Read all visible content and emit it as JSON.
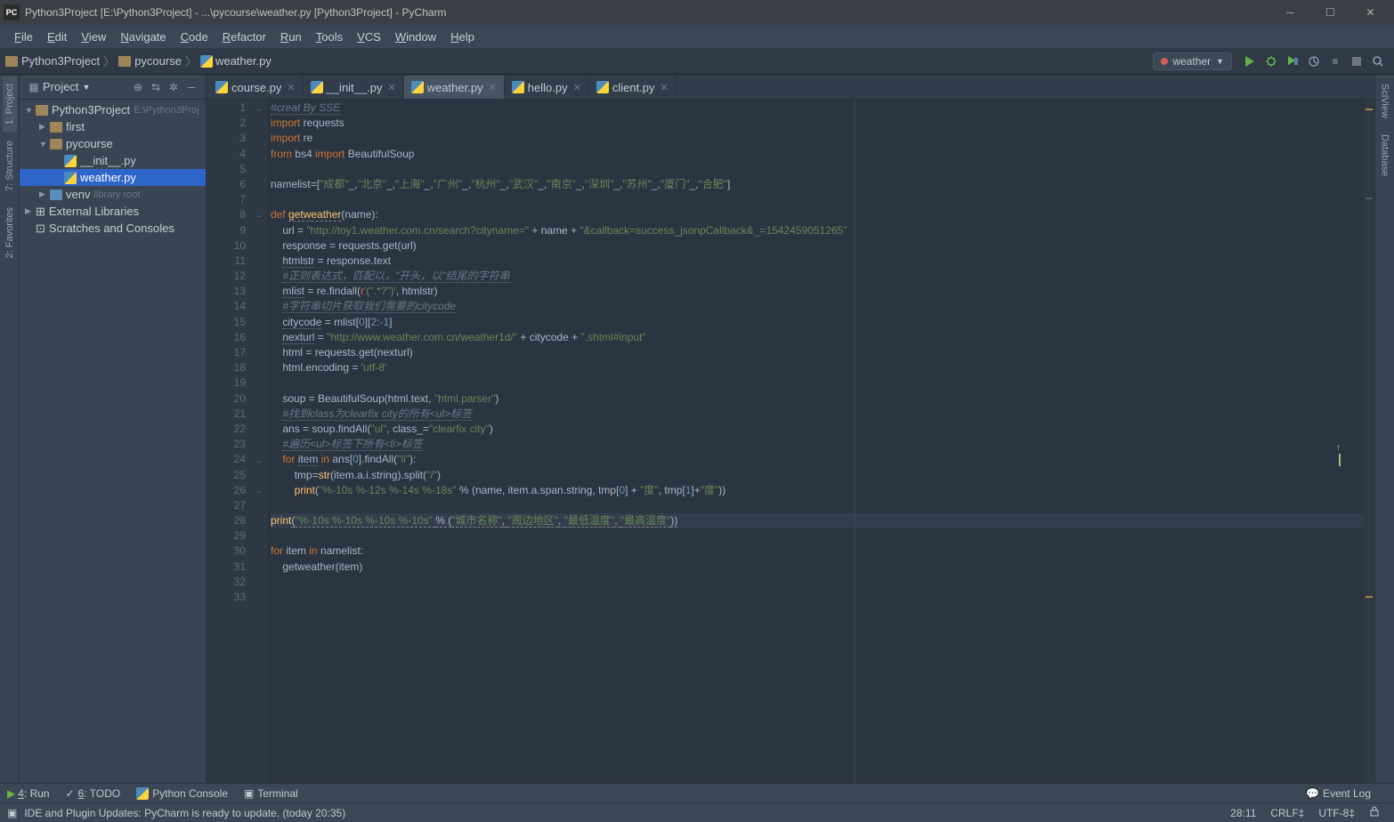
{
  "title_bar": {
    "app_badge": "PC",
    "title": "Python3Project [E:\\Python3Project] - ...\\pycourse\\weather.py [Python3Project] - PyCharm"
  },
  "menu": [
    "File",
    "Edit",
    "View",
    "Navigate",
    "Code",
    "Refactor",
    "Run",
    "Tools",
    "VCS",
    "Window",
    "Help"
  ],
  "breadcrumb": {
    "project": "Python3Project",
    "folder": "pycourse",
    "file": "weather.py"
  },
  "run_config": {
    "label": "weather"
  },
  "project_panel": {
    "title": "Project",
    "nodes": [
      {
        "depth": 0,
        "arrow": "▼",
        "icon": "dir",
        "text": "Python3Project",
        "muted": "E:\\Python3Proj"
      },
      {
        "depth": 1,
        "arrow": "▶",
        "icon": "dir",
        "text": "first"
      },
      {
        "depth": 1,
        "arrow": "▼",
        "icon": "dir",
        "text": "pycourse"
      },
      {
        "depth": 2,
        "arrow": "",
        "icon": "py",
        "text": "__init__.py"
      },
      {
        "depth": 2,
        "arrow": "",
        "icon": "py",
        "text": "weather.py",
        "selected": true
      },
      {
        "depth": 1,
        "arrow": "▶",
        "icon": "dir-blue",
        "text": "venv",
        "muted": "library root"
      },
      {
        "depth": 0,
        "arrow": "▶",
        "icon": "lib",
        "text": "External Libraries"
      },
      {
        "depth": 0,
        "arrow": "",
        "icon": "scr",
        "text": "Scratches and Consoles"
      }
    ]
  },
  "tabs": [
    {
      "label": "course.py",
      "active": false
    },
    {
      "label": "__init__.py",
      "active": false
    },
    {
      "label": "weather.py",
      "active": true
    },
    {
      "label": "hello.py",
      "active": false
    },
    {
      "label": "client.py",
      "active": false
    }
  ],
  "code": [
    {
      "n": 1,
      "tokens": [
        [
          "cmt under",
          "#creat By SSE"
        ]
      ]
    },
    {
      "n": 2,
      "tokens": [
        [
          "kw",
          "import"
        ],
        [
          "txt",
          " requests"
        ]
      ]
    },
    {
      "n": 3,
      "tokens": [
        [
          "kw",
          "import"
        ],
        [
          "txt",
          " re"
        ]
      ]
    },
    {
      "n": 4,
      "tokens": [
        [
          "kw",
          "from"
        ],
        [
          "txt",
          " bs4 "
        ],
        [
          "kw",
          "import"
        ],
        [
          "txt",
          " BeautifulSoup"
        ]
      ]
    },
    {
      "n": 5,
      "tokens": []
    },
    {
      "n": 6,
      "tokens": [
        [
          "txt",
          "namelist"
        ],
        [
          "op",
          "=["
        ],
        [
          "str",
          "\"成都\""
        ],
        [
          "op",
          "_,"
        ],
        [
          "str",
          "\"北京\""
        ],
        [
          "op",
          "_,"
        ],
        [
          "str",
          "\"上海\""
        ],
        [
          "op",
          "_,"
        ],
        [
          "str",
          "\"广州\""
        ],
        [
          "op",
          "_,"
        ],
        [
          "str",
          "\"杭州\""
        ],
        [
          "op",
          "_,"
        ],
        [
          "str",
          "\"武汉\""
        ],
        [
          "op",
          "_,"
        ],
        [
          "str",
          "\"南京\""
        ],
        [
          "op",
          "_,"
        ],
        [
          "str",
          "\"深圳\""
        ],
        [
          "op",
          "_,"
        ],
        [
          "str",
          "\"苏州\""
        ],
        [
          "op",
          "_,"
        ],
        [
          "str",
          "\"厦门\""
        ],
        [
          "op",
          "_,"
        ],
        [
          "str",
          "\"合肥\""
        ],
        [
          "op",
          "]"
        ]
      ]
    },
    {
      "n": 7,
      "tokens": []
    },
    {
      "n": 8,
      "tokens": [
        [
          "kw",
          "def "
        ],
        [
          "fn under-w",
          "getweather"
        ],
        [
          "punc",
          "("
        ],
        [
          "par",
          "name"
        ],
        [
          "punc",
          ")"
        ],
        [
          "op",
          ":"
        ]
      ]
    },
    {
      "n": 9,
      "indent": 1,
      "tokens": [
        [
          "txt",
          "url "
        ],
        [
          "op",
          "= "
        ],
        [
          "str",
          "\"http://toy1.weather.com.cn/search?cityname=\""
        ],
        [
          "op",
          " + "
        ],
        [
          "txt",
          "name"
        ],
        [
          "op",
          " + "
        ],
        [
          "str",
          "\"&callback=success_jsonpCallback&_=1542459051265\""
        ]
      ]
    },
    {
      "n": 10,
      "indent": 1,
      "tokens": [
        [
          "txt",
          "response "
        ],
        [
          "op",
          "= "
        ],
        [
          "txt",
          "requests"
        ],
        [
          "op",
          "."
        ],
        [
          "txt",
          "get"
        ],
        [
          "punc",
          "("
        ],
        [
          "txt",
          "url"
        ],
        [
          "punc",
          ")"
        ]
      ]
    },
    {
      "n": 11,
      "indent": 1,
      "tokens": [
        [
          "txt under",
          "htmlstr"
        ],
        [
          "op",
          " = "
        ],
        [
          "txt",
          "response"
        ],
        [
          "op",
          "."
        ],
        [
          "txt",
          "text"
        ]
      ]
    },
    {
      "n": 12,
      "indent": 1,
      "tokens": [
        [
          "cmt under",
          "#正则表达式，匹配以，\"开头，以\"结尾的字符串"
        ]
      ]
    },
    {
      "n": 13,
      "indent": 1,
      "tokens": [
        [
          "txt under",
          "mlist"
        ],
        [
          "op",
          " = "
        ],
        [
          "txt",
          "re"
        ],
        [
          "op",
          "."
        ],
        [
          "txt",
          "findall"
        ],
        [
          "punc",
          "("
        ],
        [
          "kw",
          "r"
        ],
        [
          "str",
          "'(\".*?\")'"
        ],
        [
          "op",
          ", "
        ],
        [
          "txt",
          "htmlstr"
        ],
        [
          "punc",
          ")"
        ]
      ]
    },
    {
      "n": 14,
      "indent": 1,
      "tokens": [
        [
          "cmt under",
          "#字符串切片获取我们需要的citycode"
        ]
      ]
    },
    {
      "n": 15,
      "indent": 1,
      "tokens": [
        [
          "txt under",
          "citycode"
        ],
        [
          "op",
          " = "
        ],
        [
          "txt",
          "mlist"
        ],
        [
          "punc",
          "["
        ],
        [
          "num",
          "0"
        ],
        [
          "punc",
          "]["
        ],
        [
          "num",
          "2"
        ],
        [
          "op",
          ":"
        ],
        [
          "num",
          "-1"
        ],
        [
          "punc",
          "]"
        ]
      ]
    },
    {
      "n": 16,
      "indent": 1,
      "tokens": [
        [
          "txt under",
          "nexturl"
        ],
        [
          "op",
          " = "
        ],
        [
          "str",
          "\"http://www.weather.com.cn/weather1d/\""
        ],
        [
          "op",
          " + "
        ],
        [
          "txt",
          "citycode"
        ],
        [
          "op",
          " + "
        ],
        [
          "str",
          "\".shtml#input\""
        ]
      ]
    },
    {
      "n": 17,
      "indent": 1,
      "tokens": [
        [
          "txt",
          "html "
        ],
        [
          "op",
          "= "
        ],
        [
          "txt",
          "requests"
        ],
        [
          "op",
          "."
        ],
        [
          "txt",
          "get"
        ],
        [
          "punc",
          "("
        ],
        [
          "txt",
          "nexturl"
        ],
        [
          "punc",
          ")"
        ]
      ]
    },
    {
      "n": 18,
      "indent": 1,
      "tokens": [
        [
          "txt",
          "html"
        ],
        [
          "op",
          "."
        ],
        [
          "txt",
          "encoding "
        ],
        [
          "op",
          "= "
        ],
        [
          "str",
          "'utf-8'"
        ]
      ]
    },
    {
      "n": 19,
      "tokens": []
    },
    {
      "n": 20,
      "indent": 1,
      "tokens": [
        [
          "txt",
          "soup "
        ],
        [
          "op",
          "= "
        ],
        [
          "txt",
          "BeautifulSoup"
        ],
        [
          "punc",
          "("
        ],
        [
          "txt",
          "html"
        ],
        [
          "op",
          "."
        ],
        [
          "txt",
          "text"
        ],
        [
          "op",
          ", "
        ],
        [
          "str",
          "\"html.parser\""
        ],
        [
          "punc",
          ")"
        ]
      ]
    },
    {
      "n": 21,
      "indent": 1,
      "tokens": [
        [
          "cmt under",
          "#找到class为clearfix city的所有<ul>标签"
        ]
      ]
    },
    {
      "n": 22,
      "indent": 1,
      "tokens": [
        [
          "txt",
          "ans "
        ],
        [
          "op",
          "= "
        ],
        [
          "txt",
          "soup"
        ],
        [
          "op",
          "."
        ],
        [
          "txt",
          "findAll"
        ],
        [
          "punc",
          "("
        ],
        [
          "str",
          "\"ul\""
        ],
        [
          "op",
          ", "
        ],
        [
          "par",
          "class_"
        ],
        [
          "op",
          "="
        ],
        [
          "str",
          "\"clearfix city\""
        ],
        [
          "punc",
          ")"
        ]
      ]
    },
    {
      "n": 23,
      "indent": 1,
      "tokens": [
        [
          "cmt under",
          "#遍历<ul>标签下所有<li>标签"
        ]
      ]
    },
    {
      "n": 24,
      "indent": 1,
      "tokens": [
        [
          "kw",
          "for "
        ],
        [
          "txt under",
          "item"
        ],
        [
          "kw",
          " in "
        ],
        [
          "txt",
          "ans"
        ],
        [
          "punc",
          "["
        ],
        [
          "num",
          "0"
        ],
        [
          "punc",
          "]"
        ],
        [
          "op",
          "."
        ],
        [
          "txt",
          "findAll"
        ],
        [
          "punc",
          "("
        ],
        [
          "str",
          "\"li\""
        ],
        [
          "punc",
          "):"
        ]
      ]
    },
    {
      "n": 25,
      "indent": 2,
      "tokens": [
        [
          "txt",
          "tmp"
        ],
        [
          "op",
          "="
        ],
        [
          "fn",
          "str"
        ],
        [
          "punc",
          "("
        ],
        [
          "txt",
          "item"
        ],
        [
          "op",
          "."
        ],
        [
          "txt",
          "a"
        ],
        [
          "op",
          "."
        ],
        [
          "txt",
          "i"
        ],
        [
          "op",
          "."
        ],
        [
          "txt",
          "string"
        ],
        [
          "punc",
          ")"
        ],
        [
          "op",
          "."
        ],
        [
          "txt",
          "split"
        ],
        [
          "punc",
          "("
        ],
        [
          "str",
          "\"/\""
        ],
        [
          "punc",
          ")"
        ]
      ]
    },
    {
      "n": 26,
      "indent": 2,
      "tokens": [
        [
          "fn",
          "print"
        ],
        [
          "punc",
          "("
        ],
        [
          "str",
          "\"%-10s %-12s %-14s %-18s\""
        ],
        [
          "op",
          " % "
        ],
        [
          "punc",
          "("
        ],
        [
          "txt",
          "name"
        ],
        [
          "op",
          ", "
        ],
        [
          "txt",
          "item"
        ],
        [
          "op",
          "."
        ],
        [
          "txt",
          "a"
        ],
        [
          "op",
          "."
        ],
        [
          "txt",
          "span"
        ],
        [
          "op",
          "."
        ],
        [
          "txt",
          "string"
        ],
        [
          "op",
          ", "
        ],
        [
          "txt",
          "tmp"
        ],
        [
          "punc",
          "["
        ],
        [
          "num",
          "0"
        ],
        [
          "punc",
          "]"
        ],
        [
          "op",
          " + "
        ],
        [
          "str",
          "\"度\""
        ],
        [
          "op",
          ", "
        ],
        [
          "txt",
          "tmp"
        ],
        [
          "punc",
          "["
        ],
        [
          "num",
          "1"
        ],
        [
          "punc",
          "]"
        ],
        [
          "op",
          "+"
        ],
        [
          "str",
          "\"度\""
        ],
        [
          "punc",
          "))"
        ]
      ]
    },
    {
      "n": 27,
      "tokens": []
    },
    {
      "n": 28,
      "hl": true,
      "tokens": [
        [
          "fn",
          "print"
        ],
        [
          "punc under-w",
          "("
        ],
        [
          "str under-w",
          "\"%-10s %-10s %-10s %-10s\" "
        ],
        [
          "op under-w",
          "% ("
        ],
        [
          "str under-w",
          "\"城市名称\""
        ],
        [
          "op under-w",
          ", "
        ],
        [
          "str under-w",
          "\"周边地区\""
        ],
        [
          "op under-w",
          ", "
        ],
        [
          "str under-w",
          "\"最低温度\""
        ],
        [
          "op under-w",
          ", "
        ],
        [
          "str under-w",
          "\"最高温度\""
        ],
        [
          "punc under-w",
          "))"
        ]
      ]
    },
    {
      "n": 29,
      "tokens": []
    },
    {
      "n": 30,
      "tokens": [
        [
          "kw",
          "for "
        ],
        [
          "txt",
          "item"
        ],
        [
          "kw",
          " in "
        ],
        [
          "txt",
          "namelist"
        ],
        [
          "op",
          ":"
        ]
      ]
    },
    {
      "n": 31,
      "indent": 1,
      "tokens": [
        [
          "txt",
          "getweather"
        ],
        [
          "punc",
          "("
        ],
        [
          "txt",
          "item"
        ],
        [
          "punc",
          ")"
        ]
      ]
    },
    {
      "n": 32,
      "tokens": []
    },
    {
      "n": 33,
      "tokens": []
    }
  ],
  "left_tabs": [
    {
      "label": "1: Project",
      "active": true
    },
    {
      "label": "7: Structure",
      "active": false
    },
    {
      "label": "2: Favorites",
      "active": false
    }
  ],
  "right_tabs": [
    {
      "label": "SciView"
    },
    {
      "label": "Database"
    }
  ],
  "bottom_bar": [
    {
      "icon": "play",
      "label": "4: Run",
      "u": "4"
    },
    {
      "icon": "todo",
      "label": "6: TODO",
      "u": "6"
    },
    {
      "icon": "py",
      "label": "Python Console"
    },
    {
      "icon": "term",
      "label": "Terminal"
    }
  ],
  "event_log": "Event Log",
  "status": {
    "msg": "IDE and Plugin Updates: PyCharm is ready to update. (today 20:35)",
    "pos": "28:11",
    "eol": "CRLF‡",
    "enc": "UTF-8‡"
  }
}
